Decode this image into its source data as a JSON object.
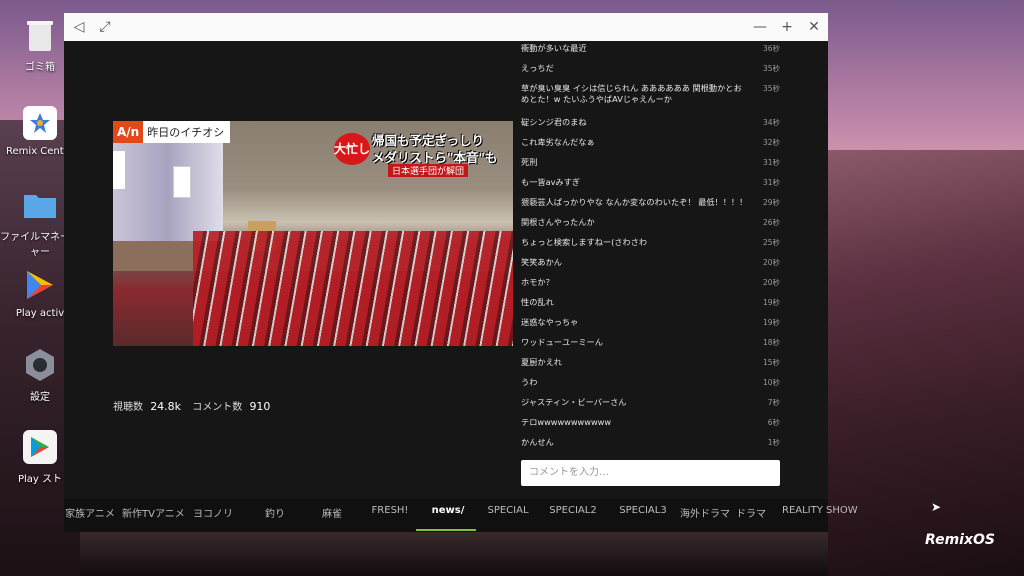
{
  "desktop": {
    "icons": [
      {
        "label": "ゴミ箱",
        "icon": "trash-icon"
      },
      {
        "label": "Remix Center",
        "icon": "remix-center-icon"
      },
      {
        "label": "ファイルマネージャー",
        "icon": "folder-icon"
      },
      {
        "label": "Play activ",
        "icon": "play-games-icon"
      },
      {
        "label": "設定",
        "icon": "settings-gear-icon"
      },
      {
        "label": "Play スト",
        "icon": "play-store-icon"
      }
    ],
    "brand_logo": "RemixOS"
  },
  "window": {
    "controls": {
      "back": "◁",
      "resize": "⤢",
      "minimize": "—",
      "maximize": "+",
      "close": "✕"
    }
  },
  "video": {
    "channel_logo": "A/n",
    "channel_tag": "昨日のイチオシ",
    "caption_badge": "大忙し",
    "caption_line1": "帰国も予定ぎっしり",
    "caption_line2": "メダリストら\"本音\"も",
    "caption_sub": "日本選手団が解団"
  },
  "stats": {
    "views_label": "視聴数",
    "views_value": "24.8k",
    "comments_label": "コメント数",
    "comments_value": "910"
  },
  "comments": [
    {
      "text": "衝動が多いな最近",
      "time": "36秒"
    },
    {
      "text": "えっちだ",
      "time": "35秒"
    },
    {
      "text": "草が臭い臭臭 イシは信じられん ああああああ 関根動かとおめとた！w たいふうやばAVじゃえんーか",
      "time": "35秒"
    },
    {
      "text": "碇シンジ君のまね",
      "time": "34秒"
    },
    {
      "text": "これ卑劣なんだなぁ",
      "time": "32秒"
    },
    {
      "text": "死刑",
      "time": "31秒"
    },
    {
      "text": "も一皆avみすぎ",
      "time": "31秒"
    },
    {
      "text": "猥褻芸人ぱっかりやな なんか変なのわいたぞ！ 最低！！！！",
      "time": "29秒"
    },
    {
      "text": "関根さんやったんか",
      "time": "26秒"
    },
    {
      "text": "ちょっと検索しますねー(さわさわ",
      "time": "25秒"
    },
    {
      "text": "笑笑あかん",
      "time": "20秒"
    },
    {
      "text": "ホモか？",
      "time": "20秒"
    },
    {
      "text": "性の乱れ",
      "time": "19秒"
    },
    {
      "text": "迷惑なやっちゃ",
      "time": "19秒"
    },
    {
      "text": "ワッドューユーミーん",
      "time": "18秒"
    },
    {
      "text": "夏厨かえれ",
      "time": "15秒"
    },
    {
      "text": "うわ",
      "time": "10秒"
    },
    {
      "text": "ジャスティン・ビーバーさん",
      "time": "7秒"
    },
    {
      "text": "テロwwwwwwwwwww",
      "time": "6秒"
    },
    {
      "text": "かんせん",
      "time": "1秒"
    }
  ],
  "comment_input": {
    "placeholder": "コメントを入力…"
  },
  "channels": [
    {
      "label": "家族アニメ",
      "active": false
    },
    {
      "label": "新作TVアニメ",
      "active": false
    },
    {
      "label": "ヨコノリ",
      "active": false
    },
    {
      "label": "釣り",
      "active": false
    },
    {
      "label": "麻雀",
      "active": false
    },
    {
      "label": "FRESH!",
      "active": false
    },
    {
      "label": "news/",
      "active": true
    },
    {
      "label": "SPECIAL",
      "active": false
    },
    {
      "label": "SPECIAL2",
      "active": false
    },
    {
      "label": "SPECIAL3",
      "active": false
    },
    {
      "label": "海外ドラマ",
      "active": false
    },
    {
      "label": "ドラマ",
      "active": false
    },
    {
      "label": "REALITY SHOW",
      "active": false
    }
  ],
  "colors": {
    "accent": "#7cc242",
    "caption_red": "#d81818",
    "channel_logo_orange": "#e04a1a"
  }
}
